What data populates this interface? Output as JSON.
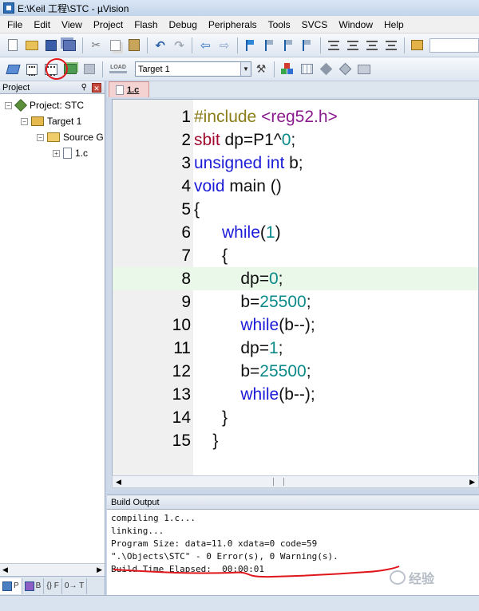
{
  "window": {
    "title": "E:\\Keil 工程\\STC - µVision"
  },
  "menu": [
    "File",
    "Edit",
    "View",
    "Project",
    "Flash",
    "Debug",
    "Peripherals",
    "Tools",
    "SVCS",
    "Window",
    "Help"
  ],
  "toolbar2": {
    "load_label": "LOAD",
    "target_selected": "Target 1"
  },
  "project": {
    "header": "Project",
    "pin": "⚲",
    "close": "✕",
    "tree": [
      {
        "label": "Project: STC",
        "level": 0,
        "expander": "−"
      },
      {
        "label": "Target 1",
        "level": 1,
        "expander": "−"
      },
      {
        "label": "Source G",
        "level": 2,
        "expander": "−"
      },
      {
        "label": "1.c",
        "level": 3,
        "expander": "+"
      }
    ],
    "tabs": [
      "P",
      "B",
      "{} F",
      "0→ T"
    ]
  },
  "editor": {
    "tab_label": "1.c",
    "current_line": 8,
    "lines": [
      {
        "n": "1",
        "parts": [
          [
            "kw-pre",
            "#include "
          ],
          [
            "kw-inc",
            "<reg52.h>"
          ]
        ]
      },
      {
        "n": "2",
        "parts": [
          [
            "kw-red",
            "sbit"
          ],
          [
            "plain",
            " dp=P1^"
          ],
          [
            "num",
            "0"
          ],
          [
            "plain",
            ";"
          ]
        ]
      },
      {
        "n": "3",
        "parts": [
          [
            "kw-blue",
            "unsigned"
          ],
          [
            "plain",
            " "
          ],
          [
            "kw-blue",
            "int"
          ],
          [
            "plain",
            " b;"
          ]
        ]
      },
      {
        "n": "4",
        "parts": [
          [
            "kw-blue",
            "void"
          ],
          [
            "plain",
            " main ()"
          ]
        ]
      },
      {
        "n": "5",
        "parts": [
          [
            "plain",
            "{"
          ]
        ]
      },
      {
        "n": "6",
        "parts": [
          [
            "plain",
            "      "
          ],
          [
            "kw-blue",
            "while"
          ],
          [
            "plain",
            "("
          ],
          [
            "num",
            "1"
          ],
          [
            "plain",
            ")"
          ]
        ]
      },
      {
        "n": "7",
        "parts": [
          [
            "plain",
            "      {"
          ]
        ]
      },
      {
        "n": "8",
        "parts": [
          [
            "plain",
            "          dp="
          ],
          [
            "num",
            "0"
          ],
          [
            "plain",
            ";"
          ]
        ]
      },
      {
        "n": "9",
        "parts": [
          [
            "plain",
            "          b="
          ],
          [
            "num",
            "25500"
          ],
          [
            "plain",
            ";"
          ]
        ]
      },
      {
        "n": "10",
        "parts": [
          [
            "plain",
            "          "
          ],
          [
            "kw-blue",
            "while"
          ],
          [
            "plain",
            "(b--);"
          ]
        ]
      },
      {
        "n": "11",
        "parts": [
          [
            "plain",
            "          dp="
          ],
          [
            "num",
            "1"
          ],
          [
            "plain",
            ";"
          ]
        ]
      },
      {
        "n": "12",
        "parts": [
          [
            "plain",
            "          b="
          ],
          [
            "num",
            "25500"
          ],
          [
            "plain",
            ";"
          ]
        ]
      },
      {
        "n": "13",
        "parts": [
          [
            "plain",
            "          "
          ],
          [
            "kw-blue",
            "while"
          ],
          [
            "plain",
            "(b--);"
          ]
        ]
      },
      {
        "n": "14",
        "parts": [
          [
            "plain",
            "      }"
          ]
        ]
      },
      {
        "n": "15",
        "parts": [
          [
            "plain",
            "    }"
          ]
        ]
      }
    ]
  },
  "build": {
    "header": "Build Output",
    "lines": [
      "compiling 1.c...",
      "linking...",
      "Program Size: data=11.0 xdata=0 code=59",
      "\".\\Objects\\STC\" - 0 Error(s), 0 Warning(s).",
      "Build Time Elapsed:  00:00:01"
    ]
  },
  "watermark": {
    "text": "经验"
  },
  "colors": {
    "annotation_red": "#e0151a",
    "current_line": "#e9f8e9",
    "keyword": "#1b1bd8"
  }
}
